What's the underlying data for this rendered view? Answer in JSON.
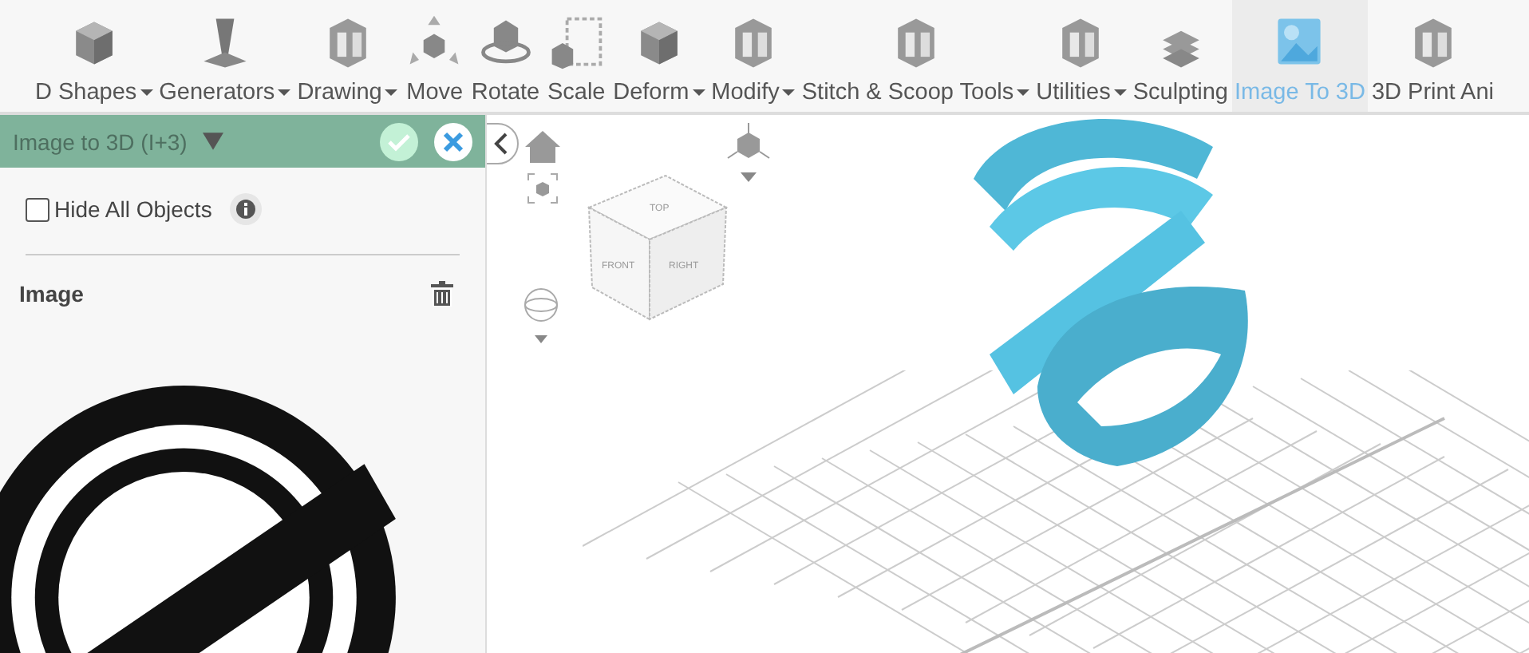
{
  "toolbar": {
    "items": [
      {
        "label": "D Shapes",
        "dropdown": true,
        "selected": false
      },
      {
        "label": "Generators",
        "dropdown": true,
        "selected": false
      },
      {
        "label": "Drawing",
        "dropdown": true,
        "selected": false
      },
      {
        "label": "Move",
        "dropdown": false,
        "selected": false
      },
      {
        "label": "Rotate",
        "dropdown": false,
        "selected": false
      },
      {
        "label": "Scale",
        "dropdown": false,
        "selected": false
      },
      {
        "label": "Deform",
        "dropdown": true,
        "selected": false
      },
      {
        "label": "Modify",
        "dropdown": true,
        "selected": false
      },
      {
        "label": "Stitch & Scoop Tools",
        "dropdown": true,
        "selected": false
      },
      {
        "label": "Utilities",
        "dropdown": true,
        "selected": false
      },
      {
        "label": "Sculpting",
        "dropdown": false,
        "selected": false
      },
      {
        "label": "Image To 3D",
        "dropdown": false,
        "selected": true
      },
      {
        "label": "3D Print Ani",
        "dropdown": false,
        "selected": false
      }
    ]
  },
  "panel": {
    "title": "Image to 3D (I+3)",
    "hide_all_objects": {
      "label": "Hide All Objects",
      "checked": false
    },
    "section": "Image"
  },
  "viewport": {
    "cube_faces": [
      "TOP",
      "FRONT",
      "RIGHT"
    ]
  }
}
